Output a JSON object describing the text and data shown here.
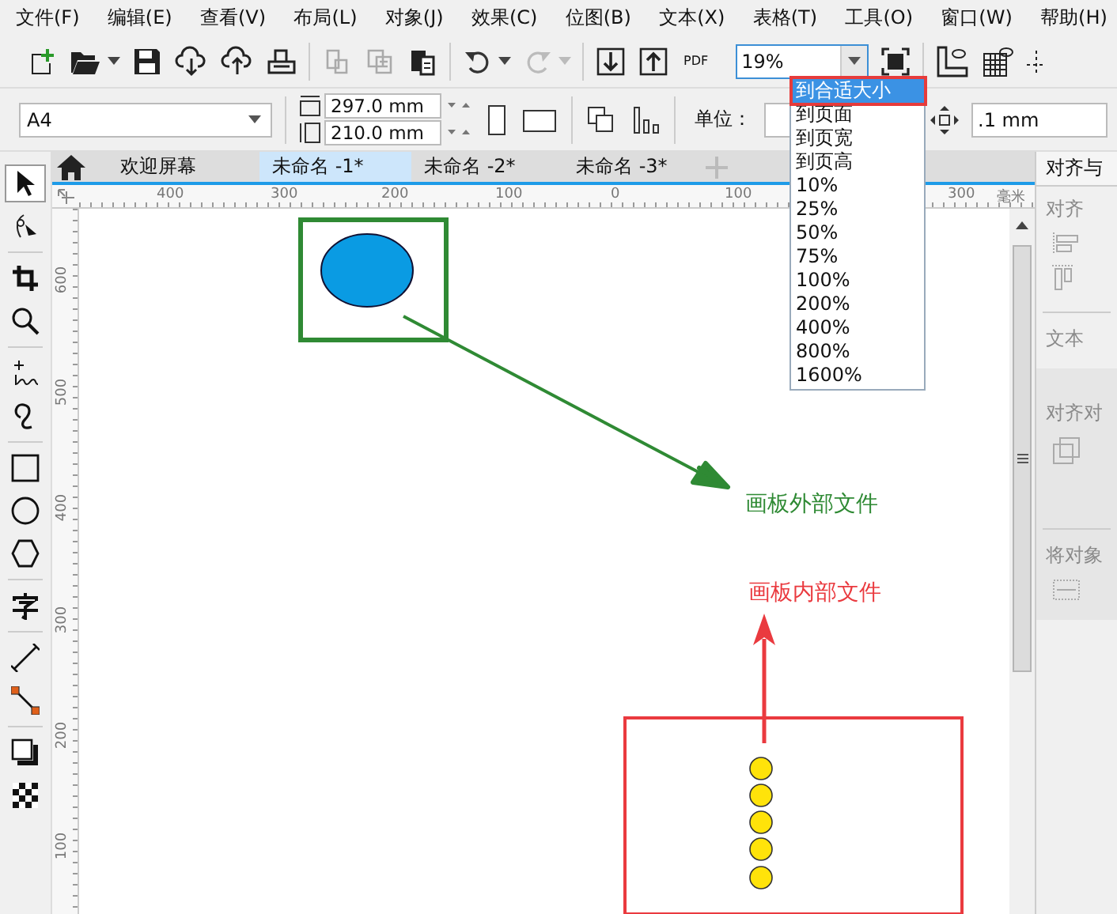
{
  "menu": [
    "文件(F)",
    "编辑(E)",
    "查看(V)",
    "布局(L)",
    "对象(J)",
    "效果(C)",
    "位图(B)",
    "文本(X)",
    "表格(T)",
    "工具(O)",
    "窗口(W)",
    "帮助(H)"
  ],
  "toolbar": {
    "pdf_label": "PDF"
  },
  "zoom": {
    "value": "19%",
    "options": [
      {
        "label": "到合适大小",
        "selected": true
      },
      {
        "label": "到页面",
        "selected": false
      },
      {
        "label": "到页宽",
        "selected": false
      },
      {
        "label": "到页高",
        "selected": false
      },
      {
        "label": "10%",
        "selected": false
      },
      {
        "label": "25%",
        "selected": false
      },
      {
        "label": "50%",
        "selected": false
      },
      {
        "label": "75%",
        "selected": false
      },
      {
        "label": "100%",
        "selected": false
      },
      {
        "label": "200%",
        "selected": false
      },
      {
        "label": "400%",
        "selected": false
      },
      {
        "label": "800%",
        "selected": false
      },
      {
        "label": "1600%",
        "selected": false
      }
    ]
  },
  "property_bar": {
    "page_size": "A4",
    "width": "297.0 mm",
    "height": "210.0 mm",
    "unit_label": "单位：",
    "nudge": ".1 mm"
  },
  "tabs": [
    {
      "label": "欢迎屏幕",
      "selected": false
    },
    {
      "label": "未命名 -1*",
      "selected": true
    },
    {
      "label": "未命名 -2*",
      "selected": false
    },
    {
      "label": "未命名 -3*",
      "selected": false
    }
  ],
  "horizontal_ruler": [
    "400",
    "300",
    "200",
    "100",
    "0",
    "100",
    "300"
  ],
  "ruler_unit": "毫米",
  "vertical_ruler": [
    "600",
    "500",
    "400",
    "300",
    "200",
    "100"
  ],
  "tools": [
    {
      "selected": true
    },
    {
      "selected": false
    },
    {
      "selected": false
    },
    {
      "selected": false
    },
    {
      "selected": false
    },
    {
      "selected": false
    },
    {
      "selected": false
    },
    {
      "selected": false
    },
    {
      "selected": false
    },
    {
      "selected": false
    },
    {
      "selected": false
    },
    {
      "selected": false
    },
    {
      "selected": false
    },
    {
      "selected": false
    }
  ],
  "docker": {
    "title": "对齐与",
    "sections": [
      "对齐",
      "文本",
      "对齐对",
      "将对象"
    ]
  },
  "annotations": [
    {
      "text": "画板外部文件",
      "color": "#2f8a34"
    },
    {
      "text": "画板内部文件",
      "color": "#ea3a3f"
    }
  ]
}
